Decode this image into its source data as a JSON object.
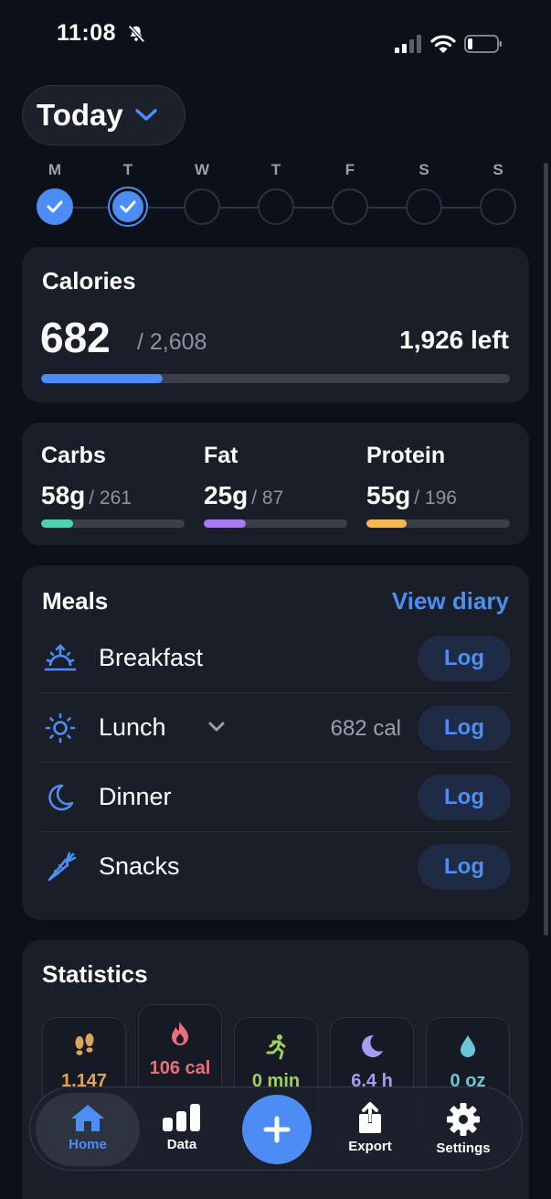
{
  "status_bar": {
    "time": "11:08"
  },
  "header": {
    "date_selector": "Today"
  },
  "week": {
    "days": [
      {
        "letter": "M",
        "state": "done"
      },
      {
        "letter": "T",
        "state": "today"
      },
      {
        "letter": "W",
        "state": "empty"
      },
      {
        "letter": "T",
        "state": "empty"
      },
      {
        "letter": "F",
        "state": "empty"
      },
      {
        "letter": "S",
        "state": "empty"
      },
      {
        "letter": "S",
        "state": "empty"
      }
    ]
  },
  "calories": {
    "title": "Calories",
    "consumed": "682",
    "goal": "/ 2,608",
    "left": "1,926 left",
    "progress": 0.26,
    "color": "#4b8cf5"
  },
  "macros": [
    {
      "name": "Carbs",
      "value": "58g",
      "goal": "/ 261",
      "progress": 0.22,
      "color": "#4fd1b0"
    },
    {
      "name": "Fat",
      "value": "25g",
      "goal": "/ 87",
      "progress": 0.29,
      "color": "#a77cf0"
    },
    {
      "name": "Protein",
      "value": "55g",
      "goal": "/ 196",
      "progress": 0.28,
      "color": "#f3b953"
    }
  ],
  "meals": {
    "title": "Meals",
    "view_diary": "View diary",
    "items": [
      {
        "name": "Breakfast",
        "icon": "sunrise-icon",
        "calories": "",
        "log": "Log"
      },
      {
        "name": "Lunch",
        "icon": "sun-icon",
        "calories": "682 cal",
        "log": "Log"
      },
      {
        "name": "Dinner",
        "icon": "moon-icon",
        "calories": "",
        "log": "Log"
      },
      {
        "name": "Snacks",
        "icon": "carrot-icon",
        "calories": "",
        "log": "Log"
      }
    ]
  },
  "statistics": {
    "title": "Statistics",
    "tiles": [
      {
        "icon": "footprints-icon",
        "value": "1,147",
        "color": "#e0a35a"
      },
      {
        "icon": "flame-icon",
        "value": "106 cal",
        "color": "#e8707a"
      },
      {
        "icon": "running-icon",
        "value": "0 min",
        "color": "#9fd05a"
      },
      {
        "icon": "moon-icon",
        "value": "6.4 h",
        "color": "#a79cf0"
      },
      {
        "icon": "water-drop-icon",
        "value": "0 oz",
        "color": "#6cc6d8"
      }
    ]
  },
  "tabbar": {
    "home": "Home",
    "data": "Data",
    "export": "Export",
    "settings": "Settings",
    "accent": "#4d8ef2"
  }
}
